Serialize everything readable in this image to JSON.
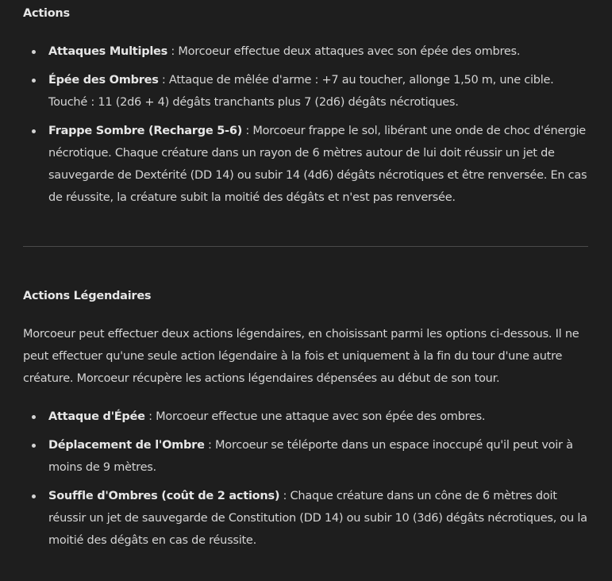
{
  "actions": {
    "heading": "Actions",
    "items": [
      {
        "name": "Attaques Multiples",
        "text": " : Morcoeur effectue deux attaques avec son épée des ombres."
      },
      {
        "name": "Épée des Ombres",
        "text": " : Attaque de mêlée d'arme : +7 au toucher, allonge 1,50 m, une cible. Touché : 11 (2d6 + 4) dégâts tranchants plus 7 (2d6) dégâts nécrotiques."
      },
      {
        "name": "Frappe Sombre (Recharge 5-6)",
        "text": " : Morcoeur frappe le sol, libérant une onde de choc d'énergie nécrotique. Chaque créature dans un rayon de 6 mètres autour de lui doit réussir un jet de sauvegarde de Dextérité (DD 14) ou subir 14 (4d6) dégâts nécrotiques et être renversée. En cas de réussite, la créature subit la moitié des dégâts et n'est pas renversée."
      }
    ]
  },
  "legendary": {
    "heading": "Actions Légendaires",
    "intro": "Morcoeur peut effectuer deux actions légendaires, en choisissant parmi les options ci-dessous. Il ne peut effectuer qu'une seule action légendaire à la fois et uniquement à la fin du tour d'une autre créature. Morcoeur récupère les actions légendaires dépensées au début de son tour.",
    "items": [
      {
        "name": "Attaque d'Épée",
        "text": " : Morcoeur effectue une attaque avec son épée des ombres."
      },
      {
        "name": "Déplacement de l'Ombre",
        "text": " : Morcoeur se téléporte dans un espace inoccupé qu'il peut voir à moins de 9 mètres."
      },
      {
        "name": "Souffle d'Ombres (coût de 2 actions)",
        "text": " : Chaque créature dans un cône de 6 mètres doit réussir un jet de sauvegarde de Constitution (DD 14) ou subir 10 (3d6) dégâts nécrotiques, ou la moitié des dégâts en cas de réussite."
      }
    ]
  }
}
